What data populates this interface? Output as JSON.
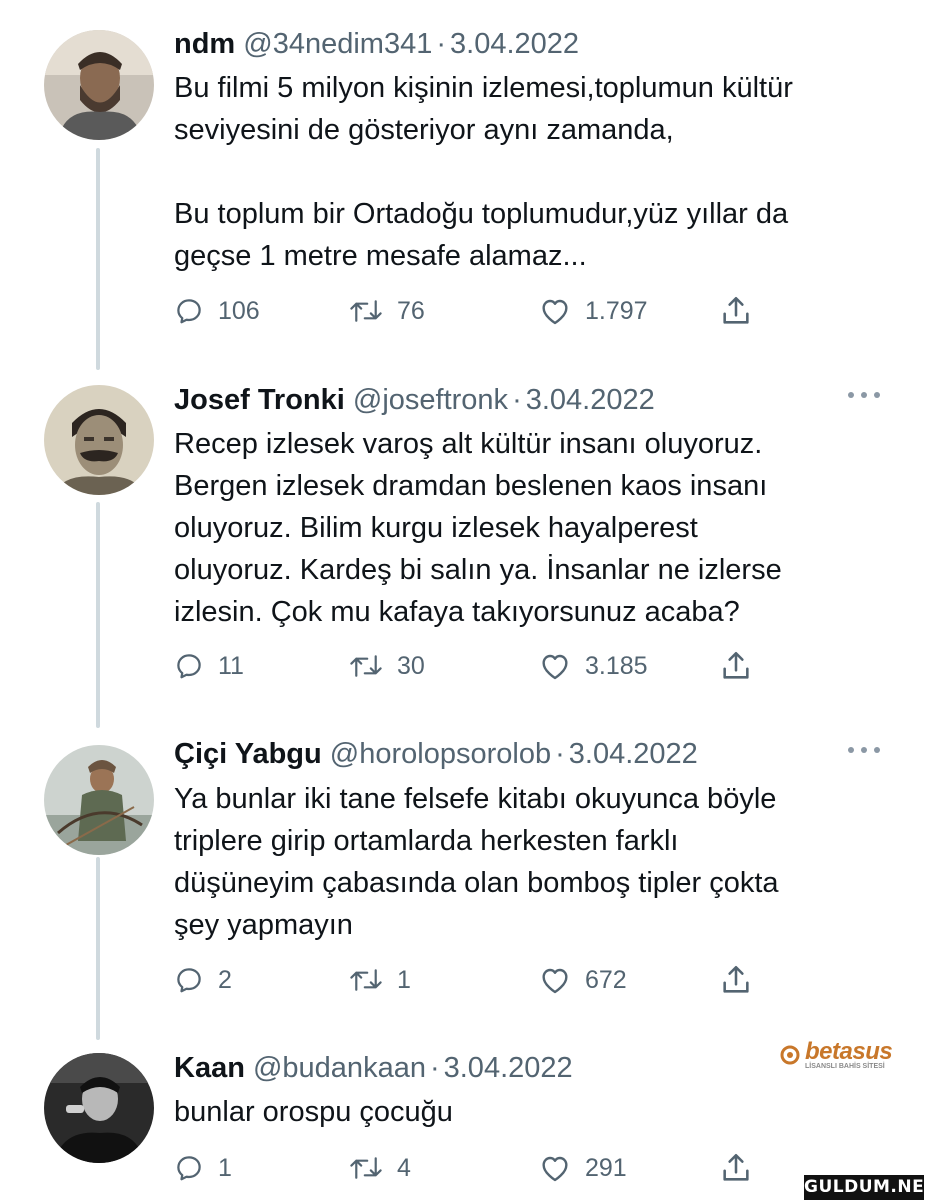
{
  "tweets": [
    {
      "name": "ndm",
      "handle": "@34nedim341",
      "separator": "·",
      "date": "3.04.2022",
      "text": "Bu filmi 5 milyon kişinin izlemesi,toplumun kültür\nseviyesini de gösteriyor aynı zamanda,\n\nBu toplum bir Ortadoğu toplumudur,yüz yıllar da\ngeçse 1 metre mesafe alamaz...",
      "replies": "106",
      "retweets": "76",
      "likes": "1.797"
    },
    {
      "name": "Josef Tronki",
      "handle": "@joseftronk",
      "separator": "·",
      "date": "3.04.2022",
      "text": "Recep izlesek varoş alt kültür insanı oluyoruz.\nBergen izlesek dramdan beslenen kaos insanı\noluyoruz. Bilim kurgu izlesek hayalperest\noluyoruz. Kardeş bi salın ya. İnsanlar ne izlerse\nizlesin. Çok mu kafaya takıyorsunuz acaba?",
      "replies": "11",
      "retweets": "30",
      "likes": "3.185"
    },
    {
      "name": "Çiçi Yabgu",
      "handle": "@horolopsorolob",
      "separator": "·",
      "date": "3.04.2022",
      "text": "Ya bunlar iki tane felsefe kitabı okuyunca böyle\ntriplere girip ortamlarda herkesten farklı\ndüşüneyim çabasında olan bomboş tipler çokta\nşey yapmayın",
      "replies": "2",
      "retweets": "1",
      "likes": "672"
    },
    {
      "name": "Kaan",
      "handle": "@budankaan",
      "separator": "·",
      "date": "3.04.2022",
      "text": "bunlar orospu çocuğu",
      "replies": "1",
      "retweets": "4",
      "likes": "291"
    }
  ],
  "brand": {
    "logo_text": "betasus",
    "tagline": "LİSANSLI BAHİS SİTESİ"
  },
  "watermark": "GULDUM.NET",
  "icons": [
    "reply-icon",
    "retweet-icon",
    "like-icon",
    "share-icon",
    "more-icon"
  ],
  "colors": {
    "text": "#0f1419",
    "secondary": "#536471",
    "thread_line": "#cfd9de",
    "brand": "#c8772a"
  }
}
